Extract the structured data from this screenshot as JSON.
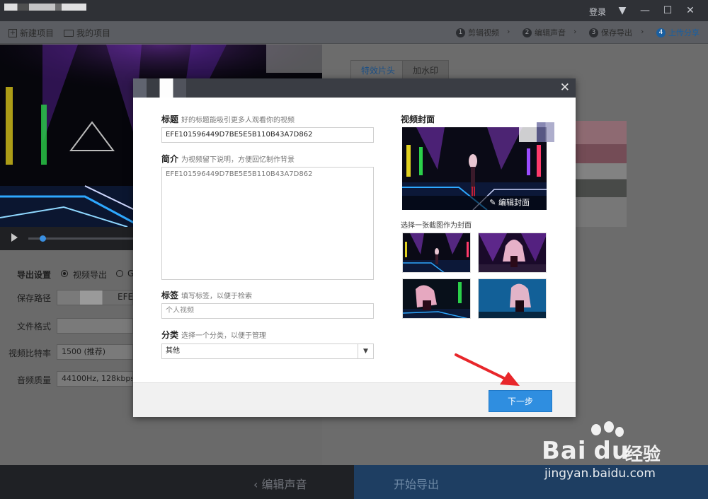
{
  "titlebar": {
    "login": "登录"
  },
  "toolbar": {
    "new_project": "新建项目",
    "my_project": "我的项目",
    "steps": [
      {
        "num": "1",
        "label": "剪辑视频"
      },
      {
        "num": "2",
        "label": "编辑声音"
      },
      {
        "num": "3",
        "label": "保存导出"
      },
      {
        "num": "4",
        "label": "上传分享"
      }
    ]
  },
  "left": {
    "export_settings_label": "导出设置",
    "radio_video_export": "视频导出",
    "radio_other": "G",
    "save_path_label": "保存路径",
    "save_path_value": "EFE1",
    "file_format_label": "文件格式",
    "bitrate_label": "视频比特率",
    "bitrate_value": "1500 (推荐)",
    "audio_quality_label": "音频质量",
    "audio_quality_value": "44100Hz, 128kbps"
  },
  "right_tabs": [
    "特效片头",
    "加水印"
  ],
  "dialog": {
    "title_label": "标题",
    "title_hint": "好的标题能吸引更多人观看你的视频",
    "title_value": "EFE101596449D7BE5E5B110B43A7D862",
    "intro_label": "简介",
    "intro_hint": "为视频留下说明，方便回忆制作背景",
    "intro_value": "EFE101596449D7BE5E5B110B43A7D862",
    "tags_label": "标签",
    "tags_hint": "填写标签，以便于检索",
    "tags_placeholder": "个人视频",
    "category_label": "分类",
    "category_hint": "选择一个分类，以便于管理",
    "category_value": "其他",
    "cover_label": "视频封面",
    "edit_cover": "编辑封面",
    "choose_frame_label": "选择一张截图作为封面",
    "next_button": "下一步"
  },
  "bottom": {
    "back": "编辑声音",
    "export": "开始导出"
  },
  "watermark": {
    "brand_a": "Bai",
    "brand_b": "du",
    "brand_cn": "经验",
    "url": "jingyan.baidu.com"
  },
  "colors": {
    "accent": "#2f8ee0",
    "arrow": "#e8262a",
    "active_step": "#1a5fa0"
  }
}
